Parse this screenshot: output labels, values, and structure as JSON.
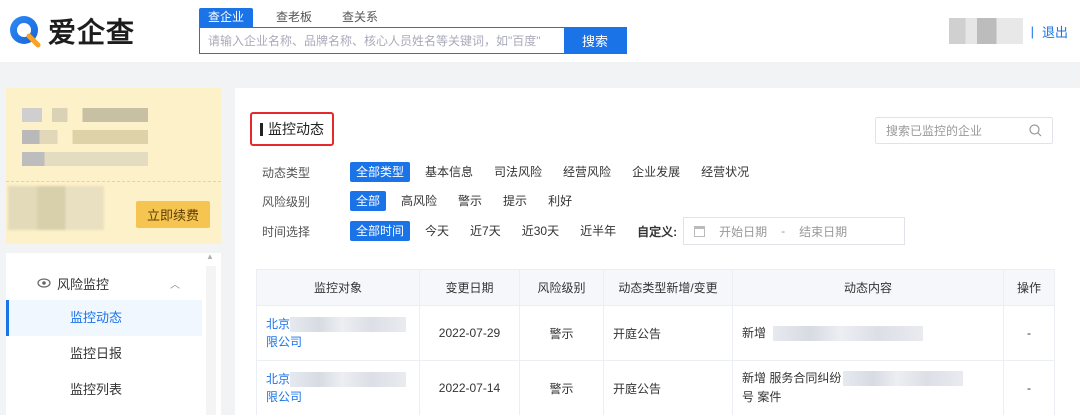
{
  "brand": {
    "name": "爱企查"
  },
  "search": {
    "tabs": [
      "查企业",
      "查老板",
      "查关系"
    ],
    "active_tab": 0,
    "placeholder": "请输入企业名称、品牌名称、核心人员姓名等关键词，如\"百度\"",
    "button": "搜索"
  },
  "user": {
    "logout": "退出",
    "separator": "|"
  },
  "sidebar": {
    "renew_button": "立即续费",
    "group_label": "风险监控",
    "items": [
      "监控动态",
      "监控日报",
      "监控列表"
    ],
    "active_item": 0
  },
  "main": {
    "title": "监控动态",
    "search_placeholder": "搜索已监控的企业",
    "filters": {
      "type": {
        "label": "动态类型",
        "options": [
          "全部类型",
          "基本信息",
          "司法风险",
          "经营风险",
          "企业发展",
          "经营状况"
        ],
        "active": 0
      },
      "risk": {
        "label": "风险级别",
        "options": [
          "全部",
          "高风险",
          "警示",
          "提示",
          "利好"
        ],
        "active": 0
      },
      "time": {
        "label": "时间选择",
        "options": [
          "全部时间",
          "今天",
          "近7天",
          "近30天",
          "近半年"
        ],
        "active": 0,
        "custom_label": "自定义:",
        "start_placeholder": "开始日期",
        "end_placeholder": "结束日期",
        "range_sep": "-"
      }
    },
    "table": {
      "headers": [
        "监控对象",
        "变更日期",
        "风险级别",
        "动态类型新增/变更",
        "动态内容",
        "操作"
      ],
      "rows": [
        {
          "company_line1": "北京",
          "company_line2": "限公司",
          "date": "2022-07-29",
          "risk": "警示",
          "type": "开庭公告",
          "content_line1": "新增",
          "content_line2": "",
          "action": "-"
        },
        {
          "company_line1": "北京",
          "company_line2": "限公司",
          "date": "2022-07-14",
          "risk": "警示",
          "type": "开庭公告",
          "content_line1": "新增 服务合同纠纷",
          "content_line2": "号 案件",
          "action": "-"
        }
      ]
    }
  },
  "colors": {
    "accent": "#1b73e8",
    "warning": "#f08c2b",
    "highlight_box": "#e42a2a",
    "vip_bg": "#fdf1c9",
    "renew_btn": "#f5c451"
  },
  "icons": [
    "logo-q-icon",
    "eye-icon",
    "chevron-up-icon",
    "search-icon",
    "calendar-icon"
  ]
}
